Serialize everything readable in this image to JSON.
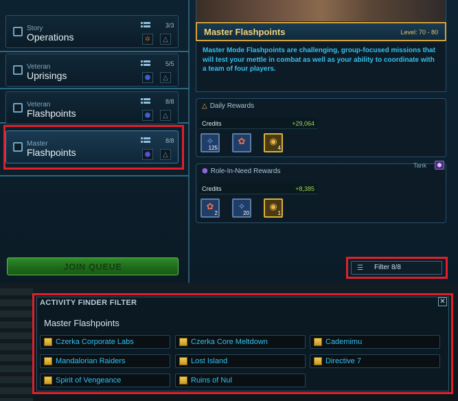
{
  "left_panel": {
    "modes": [
      {
        "sub": "Story",
        "main": "Operations",
        "count": "3/3",
        "badge": "✲"
      },
      {
        "sub": "Veteran",
        "main": "Uprisings",
        "count": "5/5",
        "badge": "⬢"
      },
      {
        "sub": "Veteran",
        "main": "Flashpoints",
        "count": "8/8",
        "badge": "⬢"
      },
      {
        "sub": "Master",
        "main": "Flashpoints",
        "count": "8/8",
        "badge": "⬢"
      }
    ],
    "join_queue_label": "JOIN QUEUE"
  },
  "detail": {
    "title": "Master Flashpoints",
    "level": "Level: 70 - 80",
    "description": "Master Mode Flashpoints are challenging, group-focused missions that will test your mettle in combat as well as your ability to coordinate with a team of four players."
  },
  "daily_rewards": {
    "header": "Daily Rewards",
    "credits_label": "Credits",
    "credits_value": "+29,064",
    "items": [
      {
        "icon": "blue-crystal-icon",
        "qty": "125"
      },
      {
        "icon": "red-flower-icon",
        "qty": ""
      },
      {
        "icon": "gold-medal-icon",
        "qty": "4"
      }
    ]
  },
  "role_rewards": {
    "header": "Role-In-Need Rewards",
    "role_label": "Tank",
    "credits_label": "Credits",
    "credits_value": "+8,385",
    "items": [
      {
        "icon": "red-flower-icon",
        "qty": "2"
      },
      {
        "icon": "blue-crystal-icon",
        "qty": "20"
      },
      {
        "icon": "gold-medal-icon",
        "qty": "1"
      }
    ]
  },
  "filter_button_label": "Filter 8/8",
  "activity_finder_filter": {
    "title": "ACTIVITY FINDER FILTER",
    "close_glyph": "✕",
    "section_title": "Master Flashpoints",
    "items": [
      "Czerka Corporate Labs",
      "Czerka Core Meltdown",
      "Cademimu",
      "Mandalorian Raiders",
      "Lost Island",
      "Directive 7",
      "Spirit of Vengeance",
      "Ruins of Nul"
    ]
  },
  "colors": {
    "accent_gold": "#d7a43a",
    "description_text": "#36c0ee",
    "credits_green": "#9ed857",
    "highlight_red": "#e0202c"
  }
}
